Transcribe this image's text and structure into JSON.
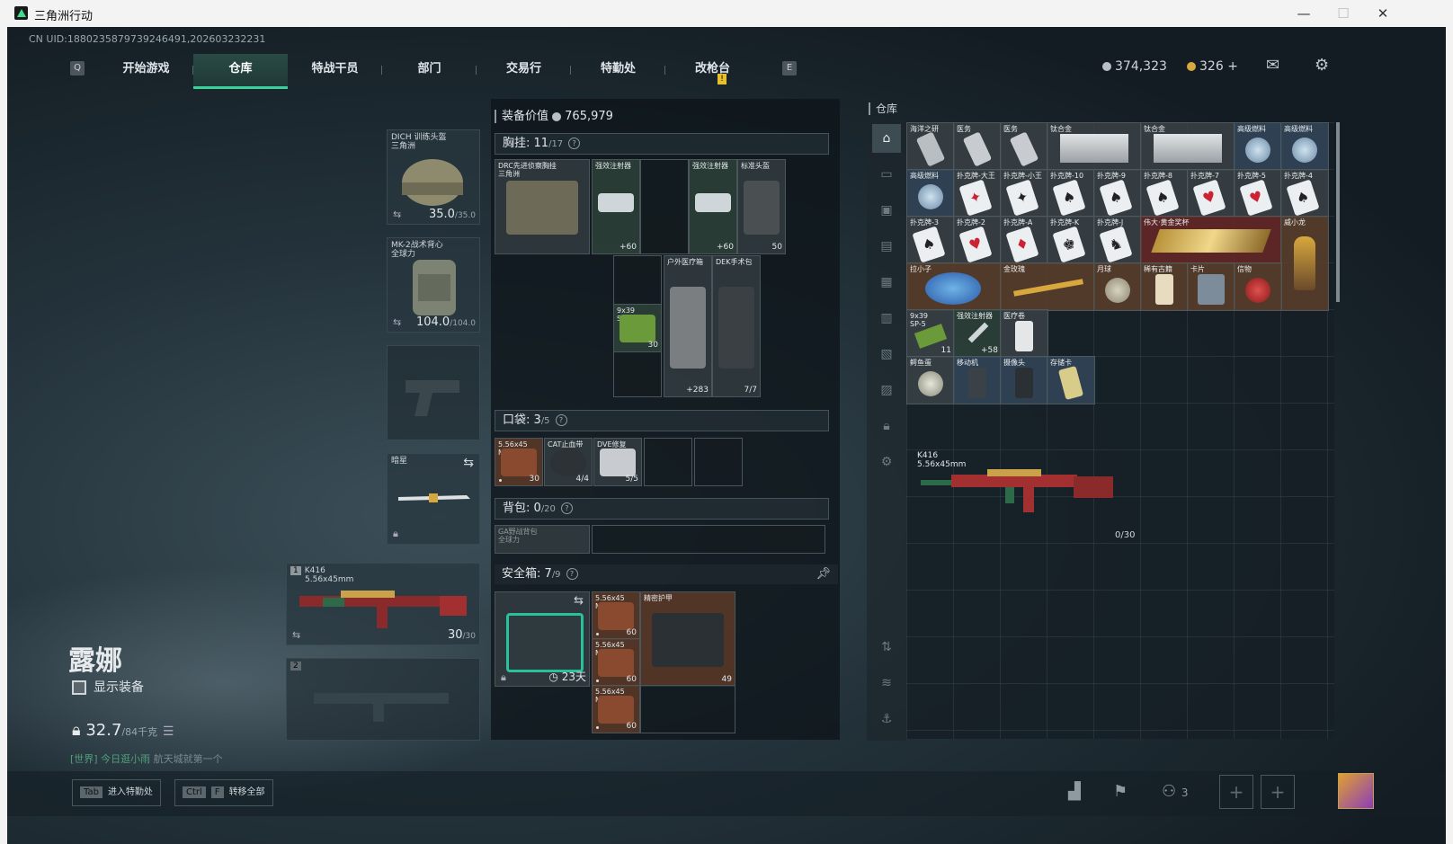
{
  "window": {
    "title": "三角洲行动",
    "minimize": "—",
    "maximize": "☐",
    "close": "✕"
  },
  "uid": "CN UID:1880235879739246491,202603232231",
  "nav": {
    "left_key": "Q",
    "right_key": "E",
    "tabs": [
      "开始游戏",
      "仓库",
      "特战干员",
      "部门",
      "交易行",
      "特勤处",
      "改枪台"
    ],
    "active_tab": "仓库",
    "alert_badge": "!"
  },
  "currency": {
    "silver": "374,323",
    "gold": "326",
    "gold_add": "+"
  },
  "equipment": {
    "helmet": {
      "label": "DICH 训练头盔\n三角洲",
      "durability": "35.0",
      "max": "/35.0"
    },
    "vest": {
      "label": "MK-2战术背心\n全球力",
      "durability": "104.0",
      "max": "/104.0"
    },
    "melee": {
      "label": "暗星"
    },
    "primary": {
      "slot": "1",
      "name": "K416",
      "caliber": "5.56x45mm",
      "ammo": "30",
      "ammo_max": "/30"
    },
    "secondary": {
      "slot": "2"
    }
  },
  "character": {
    "name": "露娜",
    "show_equipment": "显示装备",
    "weight": "32.7",
    "weight_max": "/84千克",
    "chat_channel": "[世界]",
    "chat_user": "今日逛小雨",
    "chat_text": "航天城就第一个"
  },
  "loadout": {
    "value_label": "装备价值",
    "value": "765,979",
    "chest": {
      "label": "胸挂:",
      "count": "11",
      "max": "/17"
    },
    "pockets": {
      "label": "口袋:",
      "count": "3",
      "max": "/5"
    },
    "backpack": {
      "label": "背包:",
      "count": "0",
      "max": "/20"
    },
    "safebox": {
      "label": "安全箱:",
      "count": "7",
      "max": "/9",
      "duration": "23天"
    },
    "chest_items": [
      {
        "label": "DRC先进侦察胸挂\n三角洲",
        "cnt": ""
      },
      {
        "label": "强效注射器",
        "cnt": "+60"
      },
      {
        "label": "强效注射器",
        "cnt": "+60"
      },
      {
        "label": "标准头盔",
        "cnt": "50"
      },
      {
        "label": "9x39\nSP-5",
        "cnt": "30"
      },
      {
        "label": "户外医疗箱",
        "cnt": "+283"
      },
      {
        "label": "DEK手术包",
        "cnt": "7/7"
      }
    ],
    "pocket_items": [
      {
        "label": "5.56x45\nM855",
        "cnt": "30"
      },
      {
        "label": "CAT止血带",
        "cnt": "4/4"
      },
      {
        "label": "DVE修复",
        "cnt": "5/5"
      }
    ],
    "backpack_item": {
      "label": "GA野战背包\n全球力"
    },
    "safebox_items": [
      {
        "label": "5.56x45\nM855A1",
        "cnt": "60"
      },
      {
        "label": "5.56x45\nM855A1",
        "cnt": "60"
      },
      {
        "label": "5.56x45\nM855A1",
        "cnt": "60"
      },
      {
        "label": "精密护甲",
        "cnt": "49"
      }
    ]
  },
  "storage": {
    "title": "仓库",
    "row1": [
      {
        "label": "海洋之研",
        "cnt": ""
      },
      {
        "label": "医务",
        "cnt": ""
      },
      {
        "label": "医务",
        "cnt": ""
      },
      {
        "label": "钛合金",
        "cnt": ""
      },
      {
        "label": "钛合金",
        "cnt": ""
      },
      {
        "label": "高级燃料",
        "cnt": ""
      },
      {
        "label": "高级燃料",
        "cnt": ""
      }
    ],
    "row2": [
      {
        "label": "高级燃料",
        "cnt": ""
      },
      {
        "label": "扑克牌-大王",
        "cnt": ""
      },
      {
        "label": "扑克牌-小王",
        "cnt": ""
      },
      {
        "label": "扑克牌-10",
        "cnt": ""
      },
      {
        "label": "扑克牌-9",
        "cnt": ""
      },
      {
        "label": "扑克牌-8",
        "cnt": ""
      },
      {
        "label": "扑克牌-7",
        "cnt": ""
      },
      {
        "label": "扑克牌-5",
        "cnt": ""
      },
      {
        "label": "扑克牌-4",
        "cnt": ""
      }
    ],
    "row3": [
      {
        "label": "扑克牌-3",
        "cnt": ""
      },
      {
        "label": "扑克牌-2",
        "cnt": ""
      },
      {
        "label": "扑克牌-A",
        "cnt": ""
      },
      {
        "label": "扑克牌-K",
        "cnt": ""
      },
      {
        "label": "扑克牌-J",
        "cnt": ""
      },
      {
        "label": "伟大·黄金奖杯",
        "cnt": ""
      },
      {
        "label": "威小龙",
        "cnt": ""
      }
    ],
    "row4": [
      {
        "label": "拉小子",
        "cnt": ""
      },
      {
        "label": "金玫瑰",
        "cnt": ""
      },
      {
        "label": "月球",
        "cnt": ""
      },
      {
        "label": "稀有古籍",
        "cnt": ""
      },
      {
        "label": "卡片",
        "cnt": ""
      },
      {
        "label": "信物",
        "cnt": ""
      }
    ],
    "row5": [
      {
        "label": "9x39\nSP-5",
        "cnt": "11"
      },
      {
        "label": "强效注射器",
        "cnt": "+58"
      },
      {
        "label": "医疗卷",
        "cnt": ""
      }
    ],
    "row6": [
      {
        "label": "鳄鱼蛋",
        "cnt": ""
      },
      {
        "label": "移动机",
        "cnt": ""
      },
      {
        "label": "摄像头",
        "cnt": ""
      },
      {
        "label": "存储卡",
        "cnt": ""
      }
    ],
    "gun": {
      "name": "K416",
      "caliber": "5.56x45mm",
      "ammo": "0/30"
    }
  },
  "bottom": {
    "hint1_key": "Tab",
    "hint1": "进入特勤处",
    "hint2_key1": "Ctrl",
    "hint2_key2": "F",
    "hint2": "转移全部",
    "squad": "3"
  },
  "colors": {
    "accent": "#38d29a",
    "gold": "#d7a83d",
    "alert": "#e6c12d"
  }
}
